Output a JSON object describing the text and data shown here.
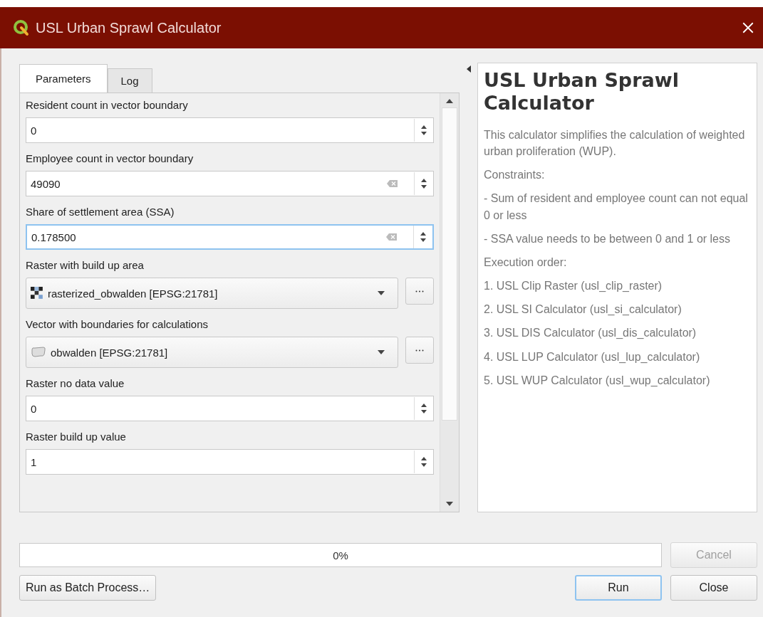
{
  "window": {
    "title": "USL Urban Sprawl Calculator"
  },
  "tabs": [
    {
      "label": "Parameters",
      "selected": true
    },
    {
      "label": "Log",
      "selected": false
    }
  ],
  "parameters": [
    {
      "kind": "spin",
      "label": "Resident count in vector boundary",
      "value": "0",
      "clearable": false,
      "focused": false
    },
    {
      "kind": "spin",
      "label": "Employee count in vector boundary",
      "value": "49090",
      "clearable": true,
      "focused": false
    },
    {
      "kind": "spin",
      "label": "Share of settlement area (SSA)",
      "value": "0.178500",
      "clearable": true,
      "focused": true
    },
    {
      "kind": "raster",
      "label": "Raster with build up area",
      "value": "rasterized_obwalden [EPSG:21781]"
    },
    {
      "kind": "vector",
      "label": "Vector with boundaries for calculations",
      "value": "obwalden [EPSG:21781]"
    },
    {
      "kind": "spin",
      "label": "Raster no data value",
      "value": "0",
      "clearable": false,
      "focused": false
    },
    {
      "kind": "spin",
      "label": "Raster build up value",
      "value": "1",
      "clearable": false,
      "focused": false
    }
  ],
  "help": {
    "title": "USL Urban Sprawl Calculator",
    "paragraphs": [
      "This calculator simplifies the calculation of weighted urban proliferation (WUP).",
      "Constraints:",
      "- Sum of resident and employee count can not equal 0 or less",
      "- SSA value needs to be between 0 and 1 or less",
      "Execution order:",
      "1. USL Clip Raster (usl_clip_raster)",
      "2. USL SI Calculator (usl_si_calculator)",
      "3. USL DIS Calculator (usl_dis_calculator)",
      "4. USL LUP Calculator (usl_lup_calculator)",
      "5. USL WUP Calculator (usl_wup_calculator)"
    ]
  },
  "progress": {
    "level": 0,
    "text": "0%"
  },
  "buttons": [
    {
      "label": "Cancel",
      "disabled": true,
      "default": false
    },
    {
      "label": "Run as Batch Process…",
      "disabled": false,
      "default": false
    },
    {
      "label": "Run",
      "disabled": false,
      "default": true
    },
    {
      "label": "Close",
      "disabled": false,
      "default": false
    }
  ]
}
